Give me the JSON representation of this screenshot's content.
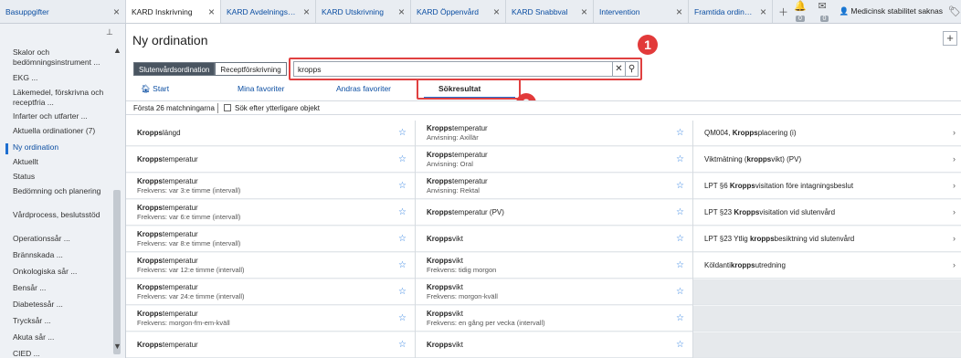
{
  "tabs": [
    {
      "label": "Basuppgifter",
      "active": false
    },
    {
      "label": "KARD Inskrivning",
      "active": true
    },
    {
      "label": "KARD Avdelningsa...",
      "active": false
    },
    {
      "label": "KARD Utskrivning",
      "active": false
    },
    {
      "label": "KARD Öppenvård",
      "active": false
    },
    {
      "label": "KARD Snabbval",
      "active": false
    },
    {
      "label": "Intervention",
      "active": false
    },
    {
      "label": "Framtida ordinatio...",
      "active": false
    }
  ],
  "tabbar": {
    "bell_count": "0",
    "mail_count": "0",
    "medicine_status": "Medicinsk stabilitet saknas"
  },
  "sidebar": {
    "items": [
      {
        "label": "Skalor och bedömningsinstrument ...",
        "active": false
      },
      {
        "label": "EKG ...",
        "active": false
      },
      {
        "label": "Läkemedel, förskrivna och receptfria ...",
        "active": false
      },
      {
        "label": "Infarter och utfarter ...",
        "active": false
      },
      {
        "label": "Aktuella ordinationer (7)",
        "active": false
      },
      {
        "label": "Ny ordination",
        "active": true
      },
      {
        "label": "Aktuellt",
        "active": false
      },
      {
        "label": "Status",
        "active": false
      },
      {
        "label": "Bedömning och planering",
        "active": false
      },
      {
        "label": "Vårdprocess, beslutsstöd",
        "active": false
      },
      {
        "label": "Operationssår ...",
        "active": false
      },
      {
        "label": "Brännskada ...",
        "active": false
      },
      {
        "label": "Onkologiska sår ...",
        "active": false
      },
      {
        "label": "Bensår ...",
        "active": false
      },
      {
        "label": "Diabetessår ...",
        "active": false
      },
      {
        "label": "Trycksår ...",
        "active": false
      },
      {
        "label": "Akuta sår ...",
        "active": false
      },
      {
        "label": "CIED ...",
        "active": false
      }
    ]
  },
  "main": {
    "title": "Ny ordination",
    "segment": {
      "selected": "Slutenvårdsordination",
      "other": "Receptförskrivning"
    },
    "search": {
      "value": "kropps"
    },
    "markers": {
      "one": "1",
      "two": "2"
    },
    "subtabs": {
      "start": "Start",
      "favorites": "Mina favoriter",
      "others_favorites": "Andras favoriter",
      "results": "Sökresultat"
    },
    "filter": {
      "match_count": "Första 26 matchningarna",
      "more_label": "Sök efter ytterligare objekt"
    }
  },
  "results": {
    "col1": [
      {
        "bold": "Kropps",
        "rest": "längd",
        "sub": ""
      },
      {
        "bold": "Kropps",
        "rest": "temperatur",
        "sub": ""
      },
      {
        "bold": "Kropps",
        "rest": "temperatur",
        "sub": "Frekvens: var 3:e timme (intervall)"
      },
      {
        "bold": "Kropps",
        "rest": "temperatur",
        "sub": "Frekvens: var 6:e timme (intervall)"
      },
      {
        "bold": "Kropps",
        "rest": "temperatur",
        "sub": "Frekvens: var 8:e timme (intervall)"
      },
      {
        "bold": "Kropps",
        "rest": "temperatur",
        "sub": "Frekvens: var 12:e timme (intervall)"
      },
      {
        "bold": "Kropps",
        "rest": "temperatur",
        "sub": "Frekvens: var 24:e timme (intervall)"
      },
      {
        "bold": "Kropps",
        "rest": "temperatur",
        "sub": "Frekvens: morgon-fm-em-kväll"
      },
      {
        "bold": "Kropps",
        "rest": "temperatur",
        "sub": ""
      }
    ],
    "col2": [
      {
        "bold": "Kropps",
        "rest": "temperatur",
        "sub": "Anvisning: Axillär"
      },
      {
        "bold": "Kropps",
        "rest": "temperatur",
        "sub": "Anvisning: Oral"
      },
      {
        "bold": "Kropps",
        "rest": "temperatur",
        "sub": "Anvisning: Rektal"
      },
      {
        "bold": "Kropps",
        "rest": "temperatur (PV)",
        "sub": ""
      },
      {
        "bold": "Kropps",
        "rest": "vikt",
        "sub": ""
      },
      {
        "bold": "Kropps",
        "rest": "vikt",
        "sub": "Frekvens: tidig morgon"
      },
      {
        "bold": "Kropps",
        "rest": "vikt",
        "sub": "Frekvens: morgon-kväll"
      },
      {
        "bold": "Kropps",
        "rest": "vikt",
        "sub": "Frekvens: en gång per vecka (intervall)"
      },
      {
        "bold": "Kropps",
        "rest": "vikt",
        "sub": ""
      }
    ],
    "col3": [
      {
        "pre": "QM004, ",
        "bold": "Kropps",
        "rest": "placering (i)"
      },
      {
        "pre": "Viktmätning (",
        "bold": "kropps",
        "rest": "vikt) (PV)"
      },
      {
        "pre": "LPT §6 ",
        "bold": "Kropps",
        "rest": "visitation före intagningsbeslut"
      },
      {
        "pre": "LPT §23 ",
        "bold": "Kropps",
        "rest": "visitation vid slutenvård"
      },
      {
        "pre": "LPT §23 Ytlig ",
        "bold": "kropps",
        "rest": "besiktning vid slutenvård"
      },
      {
        "pre": "Köldanti",
        "bold": "kropps",
        "rest": "utredning"
      }
    ]
  }
}
